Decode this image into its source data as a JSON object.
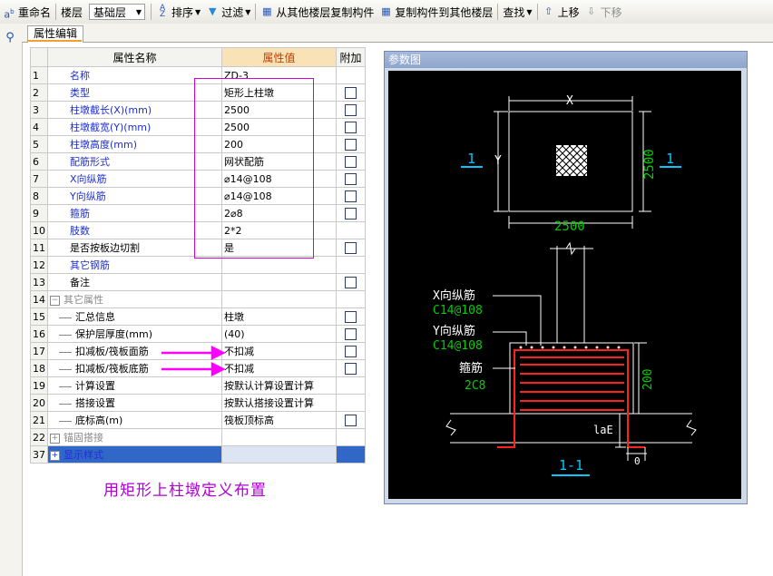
{
  "toolbar": {
    "rename": "重命名",
    "floor_label": "楼层",
    "floor_value": "基础层",
    "sort": "排序",
    "filter": "过滤",
    "copy_from_floor": "从其他楼层复制构件",
    "copy_to_floor": "复制构件到其他楼层",
    "find": "查找",
    "move_up": "上移",
    "move_down": "下移"
  },
  "tab": {
    "label": "属性编辑"
  },
  "grid": {
    "headers": [
      "属性名称",
      "属性值",
      "附加"
    ],
    "rows": [
      {
        "num": "1",
        "name": "名称",
        "value": "ZD-3",
        "check": false
      },
      {
        "num": "2",
        "name": "类型",
        "value": "矩形上柱墩",
        "check": true
      },
      {
        "num": "3",
        "name": "柱墩截长(X)(mm)",
        "value": "2500",
        "check": true
      },
      {
        "num": "4",
        "name": "柱墩截宽(Y)(mm)",
        "value": "2500",
        "check": true
      },
      {
        "num": "5",
        "name": "柱墩高度(mm)",
        "value": "200",
        "check": true
      },
      {
        "num": "6",
        "name": "配筋形式",
        "value": "网状配筋",
        "check": true
      },
      {
        "num": "7",
        "name": "X向纵筋",
        "value": "⌀14@108",
        "check": true
      },
      {
        "num": "8",
        "name": "Y向纵筋",
        "value": "⌀14@108",
        "check": true
      },
      {
        "num": "9",
        "name": "箍筋",
        "value": "2⌀8",
        "check": true
      },
      {
        "num": "10",
        "name": "肢数",
        "value": "2*2",
        "check": false
      },
      {
        "num": "11",
        "name": "是否按板边切割",
        "value": "是",
        "check": true
      },
      {
        "num": "12",
        "name": "其它钢筋",
        "value": "",
        "check": false
      },
      {
        "num": "13",
        "name": "备注",
        "value": "",
        "check": true
      },
      {
        "num": "14",
        "name": "其它属性",
        "value": "",
        "check": false
      },
      {
        "num": "15",
        "name": "汇总信息",
        "value": "柱墩",
        "check": true
      },
      {
        "num": "16",
        "name": "保护层厚度(mm)",
        "value": "(40)",
        "check": true
      },
      {
        "num": "17",
        "name": "扣减板/筏板面筋",
        "value": "不扣减",
        "check": true
      },
      {
        "num": "18",
        "name": "扣减板/筏板底筋",
        "value": "不扣减",
        "check": true
      },
      {
        "num": "19",
        "name": "计算设置",
        "value": "按默认计算设置计算",
        "check": false
      },
      {
        "num": "20",
        "name": "搭接设置",
        "value": "按默认搭接设置计算",
        "check": false
      },
      {
        "num": "21",
        "name": "底标高(m)",
        "value": "筏板顶标高",
        "check": true
      },
      {
        "num": "22",
        "name": "锚固搭接",
        "value": "",
        "check": false
      },
      {
        "num": "37",
        "name": "显示样式",
        "value": "",
        "check": false
      }
    ]
  },
  "caption": "用矩形上柱墩定义布置",
  "diagram": {
    "title": "参数图",
    "dim_x": "X",
    "dim_y": "Y",
    "dim_2500_h": "2500",
    "dim_2500_v": "2500",
    "section_mark_left": "1",
    "section_mark_right": "1",
    "label_x_bar": "X向纵筋",
    "label_x_bar_spec": "C14@108",
    "label_y_bar": "Y向纵筋",
    "label_y_bar_spec": "C14@108",
    "label_stirrup": "箍筋",
    "label_stirrup_spec": "2C8",
    "dim_200": "200",
    "dim_lae": "laE",
    "dim_0": "0",
    "section_title": "1-1"
  },
  "colors": {
    "accent": "#f0a030",
    "magenta": "#d000d0",
    "dim_green": "#00d000",
    "label_cyan": "#00c8ff",
    "rebar_red": "#ff2020"
  }
}
